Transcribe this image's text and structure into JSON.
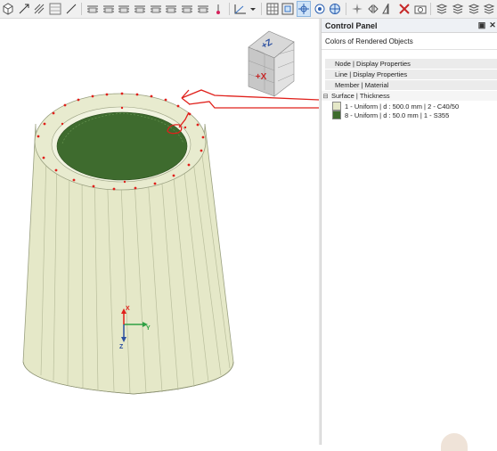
{
  "toolbar": {
    "icons": [
      "cube-icon",
      "arrow-icon",
      "hatch-icon",
      "grid-icon",
      "line-icon",
      "stack-icon",
      "stack-icon",
      "stack-icon",
      "stack-icon",
      "stack-icon",
      "stack-icon",
      "stack-icon",
      "stack-icon",
      "pin-icon",
      "view-icon",
      "dropdown-icon",
      "grid-select-icon",
      "zoom-icon",
      "rotate-icon",
      "target-icon",
      "globe-icon",
      "star-icon",
      "flip-icon",
      "mirror-icon",
      "delete-icon",
      "camera-icon",
      "layers-icon",
      "layers-icon",
      "layers-icon",
      "layers-icon"
    ]
  },
  "viewport": {
    "nav_cube": {
      "top_face": "+Z",
      "front_face": "+X"
    },
    "axes": {
      "x": "X",
      "y": "Y",
      "z": "Z"
    },
    "colors": {
      "outer_surface": "#e3e6c4",
      "inner_surface": "#3e6b2e",
      "node": "#e0201b",
      "annotation": "#e0201b"
    }
  },
  "control_panel": {
    "title": "Control Panel",
    "subtitle": "Colors of Rendered Objects",
    "groups": [
      {
        "label": "Node | Display Properties",
        "expanded": false
      },
      {
        "label": "Line | Display Properties",
        "expanded": false
      },
      {
        "label": "Member | Material",
        "expanded": false
      },
      {
        "label": "Surface | Thickness",
        "expanded": true,
        "items": [
          {
            "label": "1 - Uniform | d : 500.0 mm | 2 - C40/50",
            "color": "#e5e8c8"
          },
          {
            "label": "8 - Uniform | d : 50.0 mm | 1 - S355",
            "color": "#3e6b2e"
          }
        ]
      }
    ]
  }
}
